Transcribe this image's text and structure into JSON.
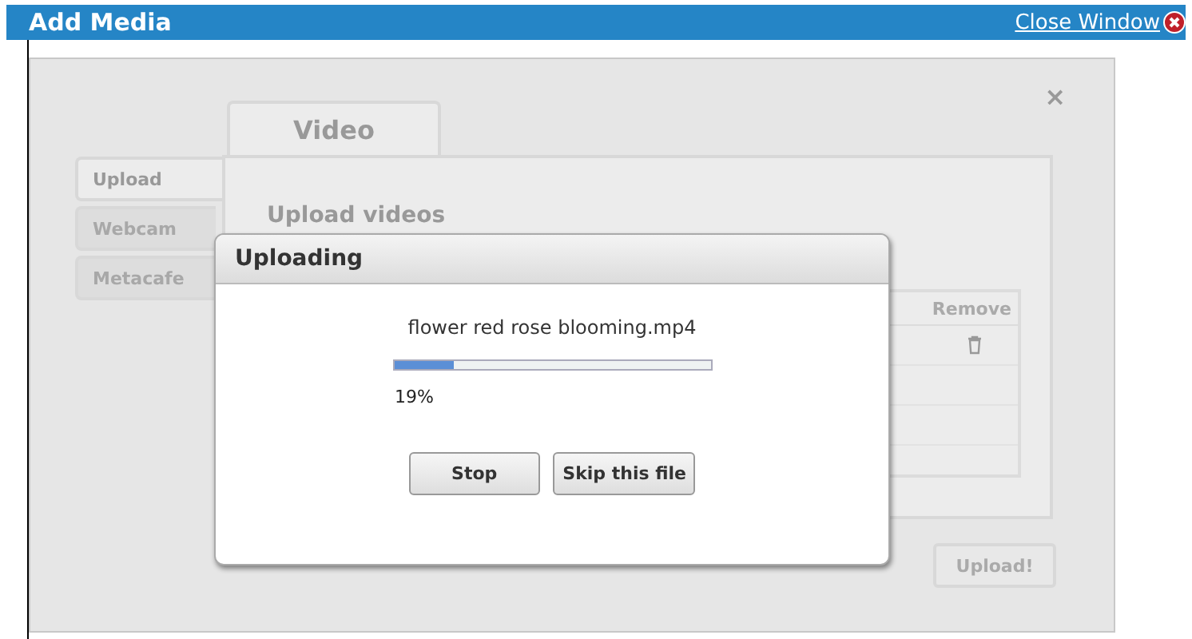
{
  "window": {
    "title": "Add Media",
    "close_link": "Close Window"
  },
  "media_panel": {
    "close_icon": "×",
    "tabs": [
      {
        "label": "Video",
        "selected": true
      }
    ],
    "side_tabs": [
      {
        "label": "Upload",
        "selected": true
      },
      {
        "label": "Webcam",
        "selected": false
      },
      {
        "label": "Metacafe",
        "selected": false
      }
    ],
    "heading": "Upload videos",
    "table": {
      "columns": [
        "Remove"
      ]
    },
    "upload_button": "Upload!"
  },
  "upload_dialog": {
    "title": "Uploading",
    "file_name": "flower red rose blooming.mp4",
    "level": 0.19,
    "percent": "19%",
    "buttons": [
      "Stop",
      "Skip this file"
    ]
  }
}
